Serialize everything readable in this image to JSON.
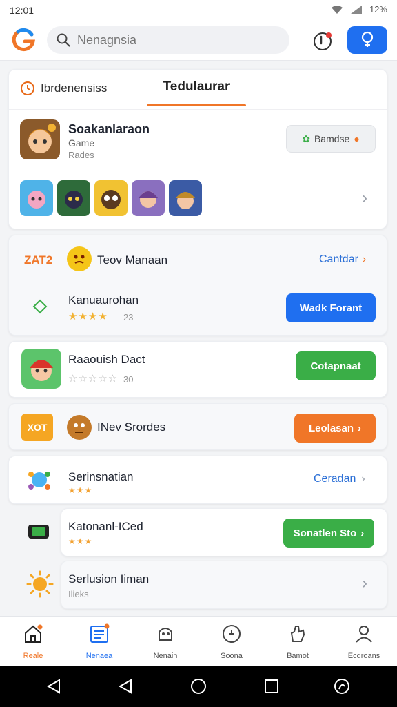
{
  "status": {
    "time": "12:01",
    "battery": "12%"
  },
  "header": {
    "search_placeholder": "Nenagnsia"
  },
  "tabs": {
    "tab1": "Ibrdenensiss",
    "tab2": "Tedulaurar"
  },
  "featured": {
    "title": "Soakanlaraon",
    "sub1": "Game",
    "sub2": "Rades",
    "button": "Bamdse"
  },
  "rows": [
    {
      "badge": "ZAT2",
      "title": "Teov Manaan",
      "action": "Cantdar"
    },
    {
      "title": "Kanuaurohan",
      "stars": "★★★★",
      "rating": "23",
      "button": "Wadk Forant"
    },
    {
      "title": "Raaouish Dact",
      "stars": "☆☆☆☆☆",
      "rating": "30",
      "button": "Cotapnaat"
    },
    {
      "badge": "XOT",
      "title": "INev Srordes",
      "button": "Leolasan"
    },
    {
      "title": "Serinsnatian",
      "stars": "★★★",
      "action": "Ceradan"
    },
    {
      "title": "Katonanl-ICed",
      "stars": "★★★",
      "button": "Sonatlen Sto"
    },
    {
      "title": "Serlusion Iiman",
      "sub": "Ilieks"
    }
  ],
  "bottom_nav": [
    {
      "label": "Reale",
      "icon": "home-icon"
    },
    {
      "label": "Nenaea",
      "icon": "news-icon"
    },
    {
      "label": "Nenain",
      "icon": "games-icon"
    },
    {
      "label": "Soona",
      "icon": "clock-icon"
    },
    {
      "label": "Bamot",
      "icon": "hand-icon"
    },
    {
      "label": "Ecdroans",
      "icon": "person-icon"
    }
  ],
  "colors": {
    "accent_orange": "#f07628",
    "primary_blue": "#1f6ff0",
    "green": "#3aae47"
  }
}
